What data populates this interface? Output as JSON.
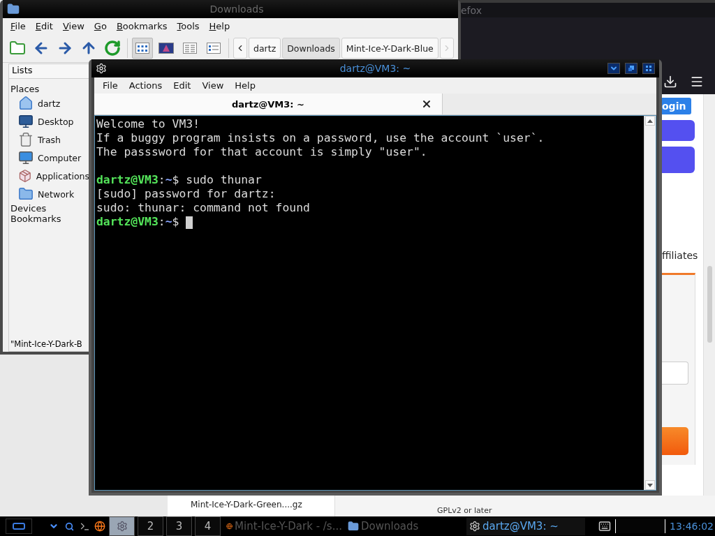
{
  "file_manager": {
    "title": "Downloads",
    "menu": [
      "File",
      "Edit",
      "View",
      "Go",
      "Bookmarks",
      "Tools",
      "Help"
    ],
    "view_modes": [
      {
        "kind": "icons",
        "selected": true
      },
      {
        "kind": "thumbnails",
        "selected": false
      },
      {
        "kind": "details",
        "selected": false
      },
      {
        "kind": "compact",
        "selected": false
      }
    ],
    "path_buttons": [
      {
        "label": "dartz",
        "selected": false
      },
      {
        "label": "Downloads",
        "selected": true
      },
      {
        "label": "Mint-Ice-Y-Dark-Blue",
        "selected": false
      }
    ],
    "path_next_disabled": true,
    "sidebar": {
      "header": "Lists",
      "sections": [
        {
          "label": "Places",
          "items": [
            {
              "label": "dartz",
              "kind": "home"
            },
            {
              "label": "Desktop",
              "kind": "desktop"
            },
            {
              "label": "Trash",
              "kind": "trash"
            },
            {
              "label": "Computer",
              "kind": "computer"
            },
            {
              "label": "Applications",
              "kind": "applications"
            },
            {
              "label": "Network",
              "kind": "network"
            }
          ]
        },
        {
          "label": "Devices"
        },
        {
          "label": "Bookmarks"
        }
      ]
    },
    "status": "\"Mint-Ice-Y-Dark-B"
  },
  "browser": {
    "title": "efox",
    "login": "ogin",
    "affiliates": "ffiliates",
    "download_name": "Mint-Ice-Y-Dark-Green....gz",
    "license": "GPLv2 or later"
  },
  "terminal": {
    "title": "dartz@VM3: ~",
    "menu": [
      "File",
      "Actions",
      "Edit",
      "View",
      "Help"
    ],
    "tabs": [
      {
        "label": "dartz@VM3: ~",
        "selected": true
      }
    ],
    "lines": [
      {
        "kind": "text",
        "text": "Welcome to VM3!"
      },
      {
        "kind": "text",
        "text": "If a buggy program insists on a password, use the account `user`."
      },
      {
        "kind": "text",
        "text": "The passsword for that account is simply \"user\"."
      },
      {
        "kind": "blank"
      },
      {
        "kind": "prompt",
        "user": "dartz@VM3",
        "separator": ":",
        "path": "~",
        "symbol": "$",
        "command": "sudo thunar",
        "cursor": false
      },
      {
        "kind": "text",
        "text": "[sudo] password for dartz:"
      },
      {
        "kind": "text",
        "text": "sudo: thunar: command not found"
      },
      {
        "kind": "prompt",
        "user": "dartz@VM3",
        "separator": ":",
        "path": "~",
        "symbol": "$",
        "cursor": true
      }
    ]
  },
  "taskbar": {
    "workspaces": [
      {
        "selected": true
      },
      {
        "label": "2",
        "selected": false
      },
      {
        "label": "3",
        "selected": false
      },
      {
        "label": "4",
        "selected": false
      }
    ],
    "tasks": [
      {
        "kind": "browser",
        "label": "Mint-Ice-Y-Dark - /s...",
        "selected": false
      },
      {
        "kind": "folder",
        "label": "Downloads",
        "selected": false
      },
      {
        "kind": "terminal",
        "label": "dartz@VM3: ~",
        "selected": true
      }
    ],
    "clock": "13:46:02"
  }
}
